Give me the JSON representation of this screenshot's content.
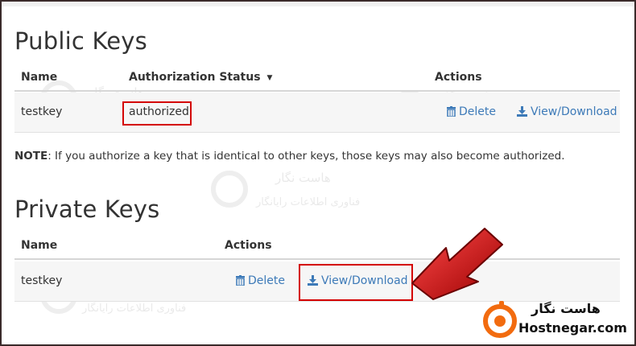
{
  "public_keys": {
    "title": "Public Keys",
    "headers": {
      "name": "Name",
      "status": "Authorization Status",
      "actions": "Actions"
    },
    "rows": [
      {
        "name": "testkey",
        "status": "authorized",
        "delete_label": "Delete",
        "view_label": "View/Download"
      }
    ],
    "note_prefix": "NOTE",
    "note_text": ": If you authorize a key that is identical to other keys, those keys may also become authorized."
  },
  "private_keys": {
    "title": "Private Keys",
    "headers": {
      "name": "Name",
      "actions": "Actions"
    },
    "rows": [
      {
        "name": "testkey",
        "delete_label": "Delete",
        "view_label": "View/Download"
      }
    ]
  },
  "watermark": {
    "line1": "هاست نگار",
    "line2": "فناوری اطلاعات رایانگار"
  },
  "logo": {
    "persian": "هاست نگار",
    "english": "Hostnegar.com"
  },
  "colors": {
    "link": "#3d7ab8",
    "highlight": "#d40000",
    "arrow": "#c80000",
    "logo_orange": "#f26b0f"
  },
  "icons": {
    "delete": "trash-icon",
    "download": "download-icon",
    "sort": "sort-caret-icon",
    "pointer": "red-arrow-icon"
  }
}
